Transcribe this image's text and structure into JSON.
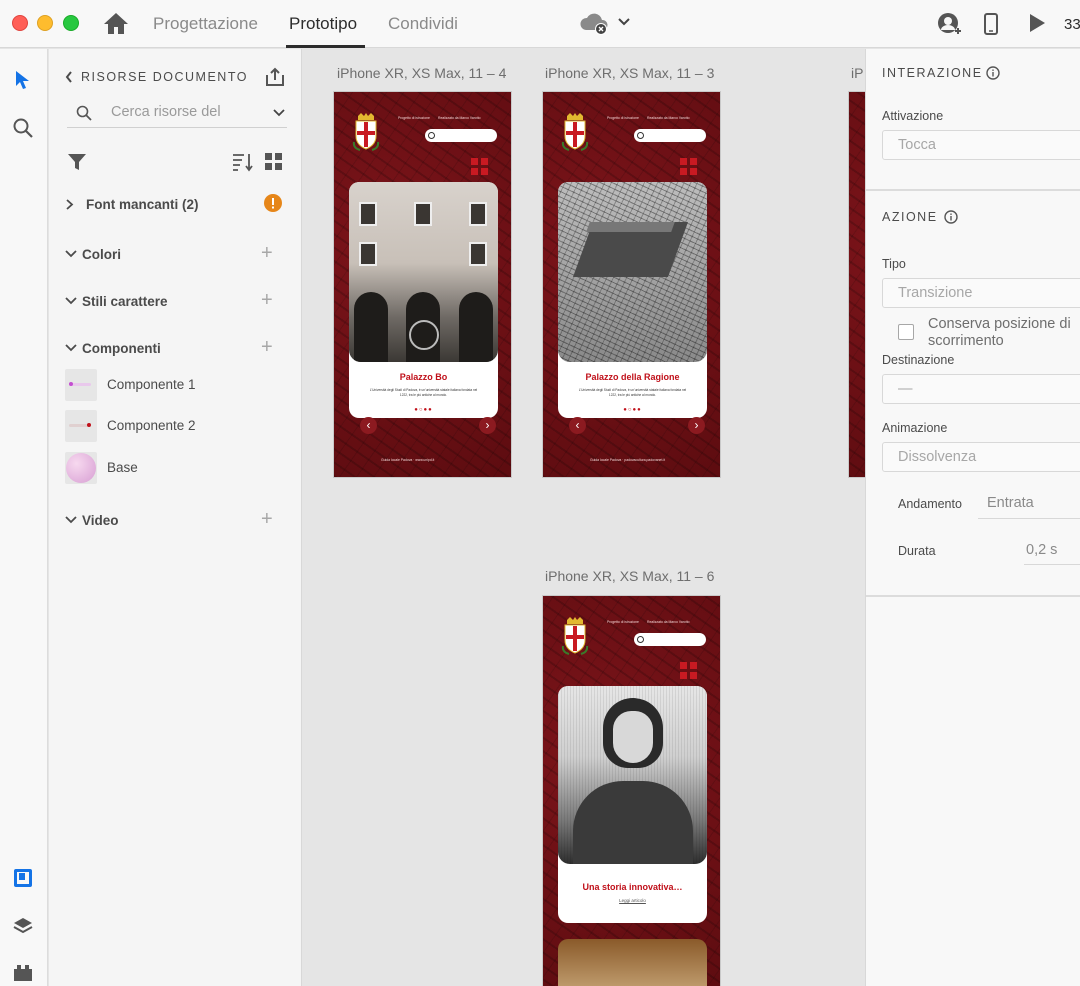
{
  "topbar": {
    "tabs": [
      {
        "label": "Progettazione"
      },
      {
        "label": "Prototipo"
      },
      {
        "label": "Condividi"
      }
    ],
    "zoom": "33",
    "icons": [
      "home-icon",
      "cloud-offline-icon",
      "chevron-down-icon",
      "user-invite-icon",
      "device-preview-icon",
      "play-icon"
    ]
  },
  "assets": {
    "title": "RISORSE DOCUMENTO",
    "search_placeholder": "Cerca risorse del",
    "missing_fonts": "Font mancanti (2)",
    "sections": {
      "colors": "Colori",
      "char_styles": "Stili carattere",
      "components": "Componenti",
      "video": "Video"
    },
    "components": [
      {
        "label": "Componente 1"
      },
      {
        "label": "Componente 2"
      },
      {
        "label": "Base"
      }
    ]
  },
  "canvas": {
    "artboards": [
      {
        "label": "iPhone XR, XS Max, 11 – 4",
        "card_title": "Palazzo  Bo",
        "card_text": "L'Università degli Studi di Padova, è un'università statale italiana fondata nel 1222, tra le più antiche al mondo.",
        "footer": "Guida locale Padova · www.unipd.it",
        "header_a": "Progetto di istruzione",
        "header_b": "Realizzato da Marco Varotto"
      },
      {
        "label": "iPhone XR, XS Max, 11 – 3",
        "card_title": "Palazzo della Ragione",
        "card_text": "L'Università degli Studi di Padova, è un'università statale italiana fondata nel 1222, tra le più antiche al mondo.",
        "footer": "Guida locale Padova · padovacultura.padovanet.it",
        "header_a": "Progetto di istruzione",
        "header_b": "Realizzato da Marco Varotto"
      },
      {
        "label": "iPhone XR, XS Max, 11 – 6",
        "card_title": "Una storia innovativa…",
        "link": "Leggi articolo",
        "header_a": "Progetto di istruzione",
        "header_b": "Realizzato da Marco Varotto"
      }
    ],
    "partial_label": "iP"
  },
  "properties": {
    "interaction_title": "INTERAZIONE",
    "trigger_label": "Attivazione",
    "trigger_value": "Tocca",
    "action_title": "AZIONE",
    "type_label": "Tipo",
    "type_value": "Transizione",
    "keep_scroll_label": "Conserva posizione di scorrimento",
    "destination_label": "Destinazione",
    "destination_value": "—",
    "animation_label": "Animazione",
    "animation_value": "Dissolvenza",
    "easing_label": "Andamento",
    "easing_value": "Entrata",
    "duration_label": "Durata",
    "duration_value": "0,2 s"
  },
  "colors": {
    "brand_red": "#6b0f14",
    "accent_red": "#c0101a",
    "accent_blue": "#1473e6"
  }
}
